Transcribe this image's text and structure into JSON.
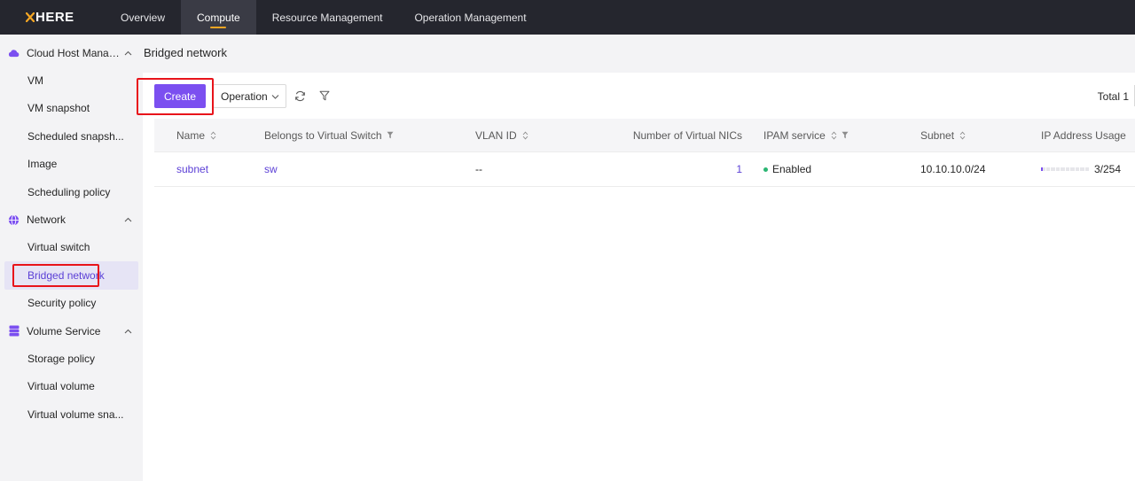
{
  "app": {
    "logo": "XHERE"
  },
  "topnav": [
    {
      "label": "Overview"
    },
    {
      "label": "Compute",
      "active": true
    },
    {
      "label": "Resource Management"
    },
    {
      "label": "Operation Management"
    }
  ],
  "sidebar": {
    "groups": [
      {
        "label": "Cloud Host Manage...",
        "icon": "cloud-icon",
        "items": [
          "VM",
          "VM snapshot",
          "Scheduled snapsh...",
          "Image",
          "Scheduling policy"
        ]
      },
      {
        "label": "Network",
        "icon": "globe-icon",
        "items": [
          "Virtual switch",
          "Bridged network",
          "Security policy"
        ]
      },
      {
        "label": "Volume Service",
        "icon": "database-icon",
        "items": [
          "Storage policy",
          "Virtual volume",
          "Virtual volume sna..."
        ]
      }
    ],
    "active_item": "Bridged network"
  },
  "page": {
    "title": "Bridged network"
  },
  "toolbar": {
    "create_label": "Create",
    "operation_label": "Operation",
    "total_label": "Total 1"
  },
  "table": {
    "columns": [
      {
        "label": "Name",
        "sort": true,
        "filter": false
      },
      {
        "label": "Belongs to Virtual Switch",
        "sort": false,
        "filter": true
      },
      {
        "label": "VLAN ID",
        "sort": true,
        "filter": false
      },
      {
        "label": "Number of Virtual NICs",
        "sort": false,
        "filter": false
      },
      {
        "label": "IPAM service",
        "sort": true,
        "filter": true
      },
      {
        "label": "Subnet",
        "sort": true,
        "filter": false
      },
      {
        "label": "IP Address Usage",
        "sort": false,
        "filter": false
      }
    ],
    "rows": [
      {
        "name": "subnet",
        "virtual_switch": "sw",
        "vlan_id": "--",
        "nic_count": "1",
        "ipam_service": "Enabled",
        "subnet": "10.10.10.0/24",
        "ip_usage": "3/254",
        "ip_usage_fraction": 0.012
      }
    ]
  },
  "colors": {
    "accent": "#7b4ff0",
    "link": "#5b3fd6",
    "enabled": "#2bb673",
    "highlight": "#e8141b",
    "topbar": "#25262e"
  }
}
